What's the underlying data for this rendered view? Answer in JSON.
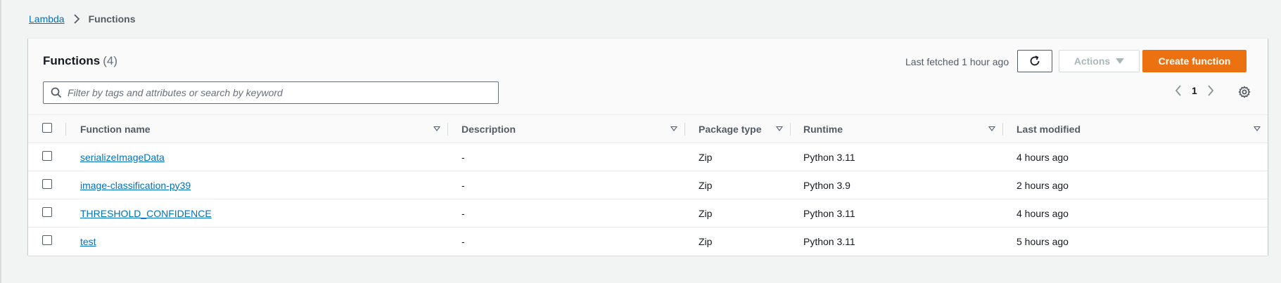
{
  "breadcrumb": {
    "root": "Lambda",
    "current": "Functions"
  },
  "panel": {
    "title": "Functions",
    "count": "(4)",
    "last_fetched": "Last fetched 1 hour ago",
    "actions_label": "Actions",
    "create_label": "Create function",
    "search_placeholder": "Filter by tags and attributes or search by keyword",
    "page_number": "1"
  },
  "table": {
    "columns": [
      "Function name",
      "Description",
      "Package type",
      "Runtime",
      "Last modified"
    ],
    "rows": [
      {
        "name": "serializeImageData",
        "description": "-",
        "package": "Zip",
        "runtime": "Python 3.11",
        "modified": "4 hours ago"
      },
      {
        "name": "image-classification-py39",
        "description": "-",
        "package": "Zip",
        "runtime": "Python 3.9",
        "modified": "2 hours ago"
      },
      {
        "name": "THRESHOLD_CONFIDENCE",
        "description": "-",
        "package": "Zip",
        "runtime": "Python 3.11",
        "modified": "4 hours ago"
      },
      {
        "name": "test",
        "description": "-",
        "package": "Zip",
        "runtime": "Python 3.11",
        "modified": "5 hours ago"
      }
    ]
  },
  "colors": {
    "link": "#0073bb",
    "primary_button": "#ec7211",
    "background": "#f2f3f3"
  }
}
